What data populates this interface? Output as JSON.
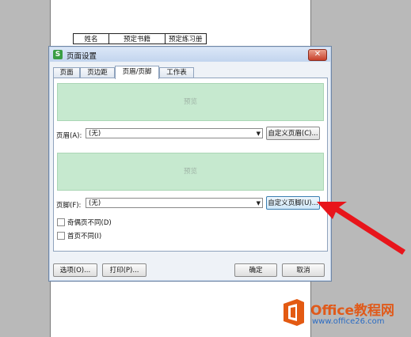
{
  "document": {
    "table_row": [
      "姓名",
      "预定书籍",
      "预定练习册"
    ]
  },
  "dialog": {
    "title": "页面设置",
    "tabs": [
      "页面",
      "页边距",
      "页眉/页脚",
      "工作表"
    ],
    "active_tab": "页眉/页脚",
    "header_preview_label": "预览",
    "footer_preview_label": "预览",
    "header_label": "页眉(A):",
    "header_value": "(无)",
    "custom_header_button": "自定义页眉(C)...",
    "footer_label": "页脚(F):",
    "footer_value": "(无)",
    "custom_footer_button": "自定义页脚(U)...",
    "odd_even_checkbox": "奇偶页不同(D)",
    "first_page_checkbox": "首页不同(I)",
    "options_button": "选项(O)...",
    "print_button": "打印(P)...",
    "ok_button": "确定",
    "cancel_button": "取消"
  },
  "watermark": {
    "brand": "Office教程网",
    "url": "www.office26.com"
  },
  "colors": {
    "preview_bg": "#c6e9cf",
    "arrow": "#e8151b",
    "brand_orange": "#e05a1a"
  }
}
